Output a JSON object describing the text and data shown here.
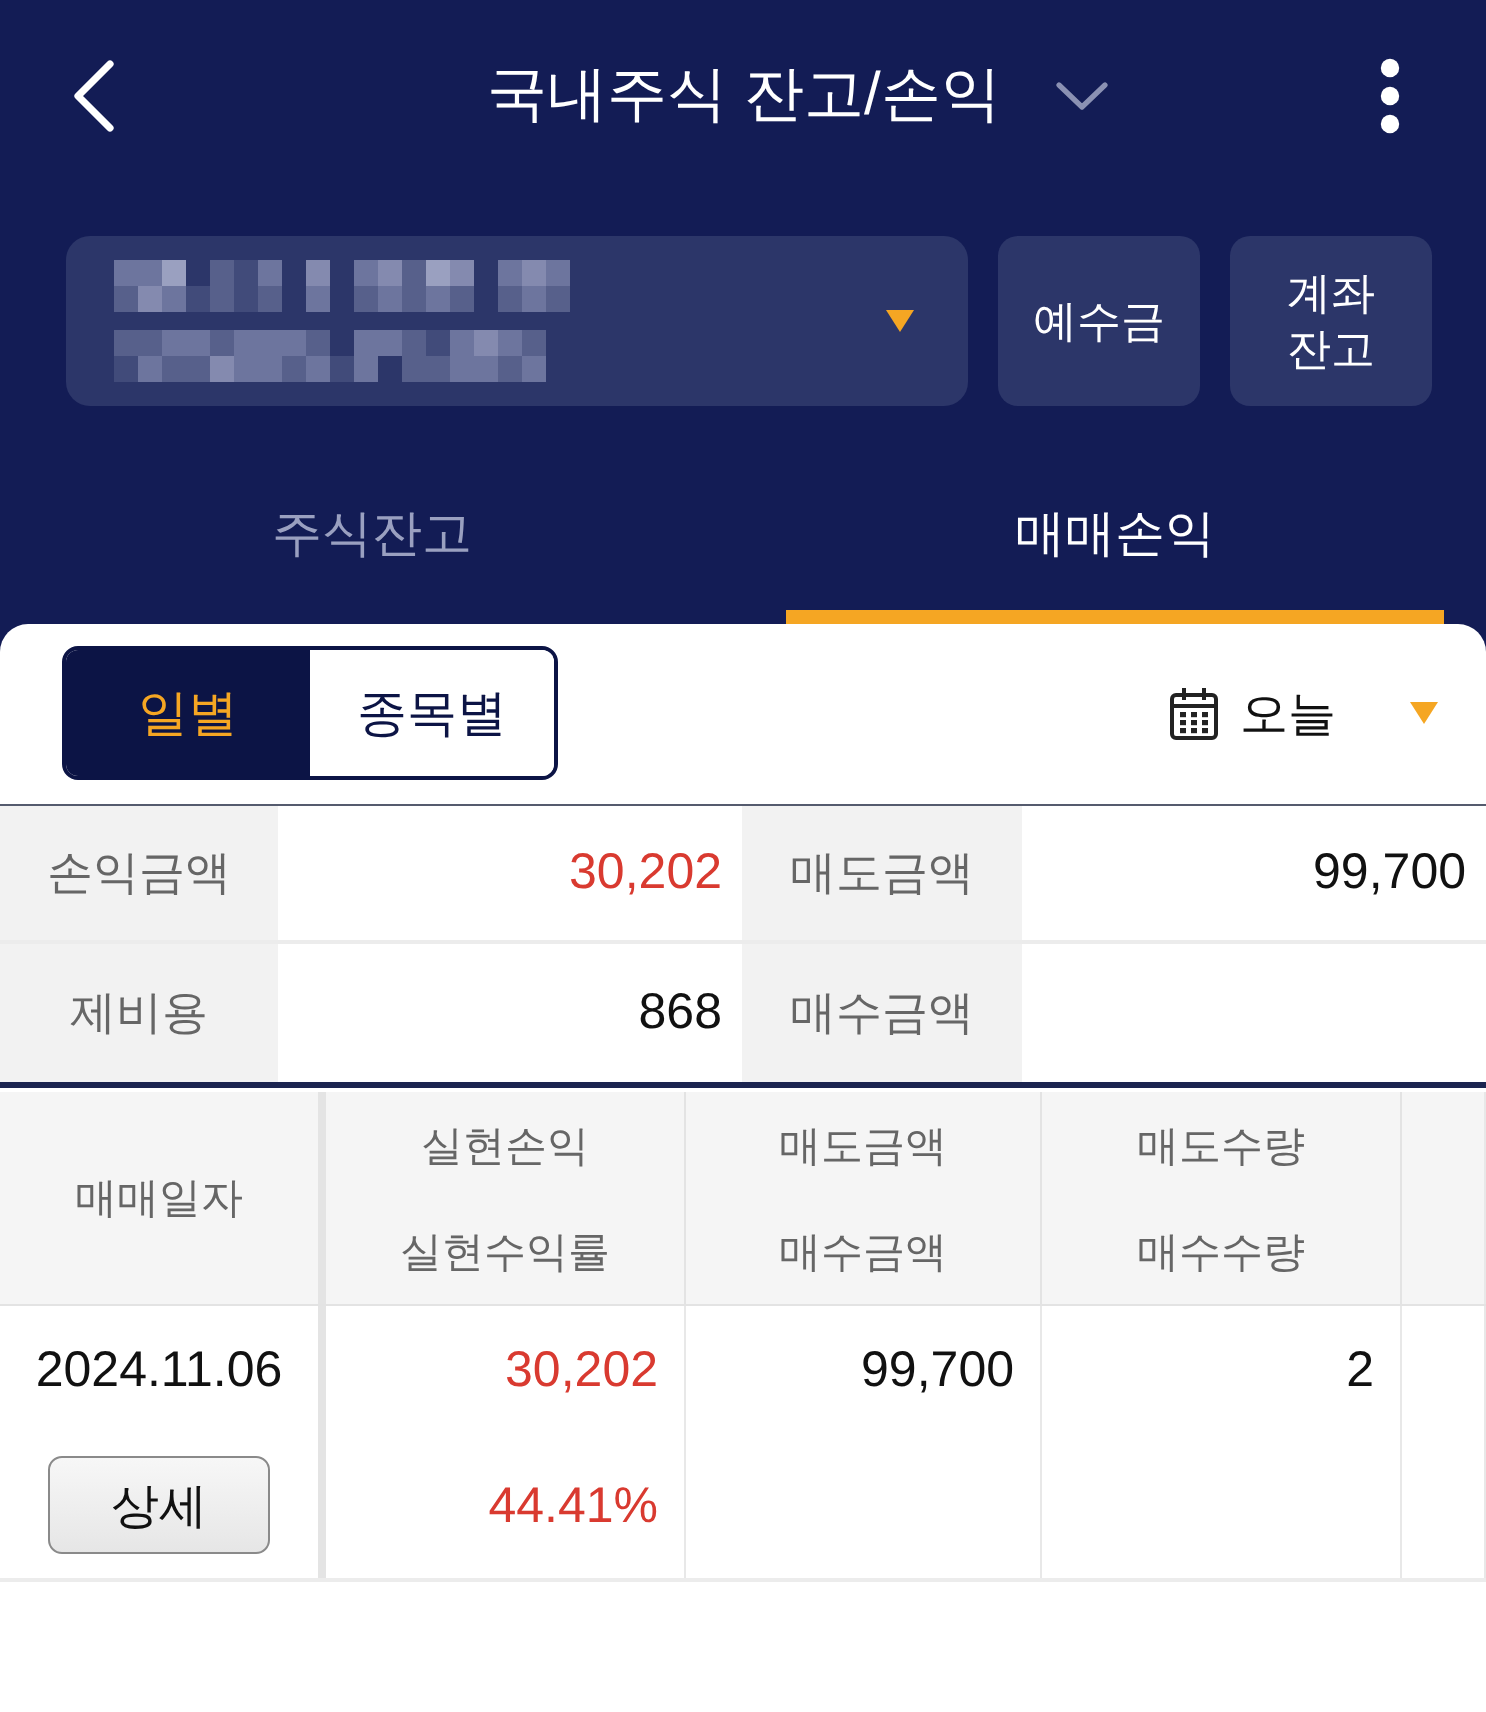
{
  "header": {
    "title": "국내주식 잔고/손익"
  },
  "account": {
    "buttons": [
      "예수금",
      "계좌 잔고"
    ]
  },
  "tabs": [
    {
      "label": "주식잔고",
      "selected": false
    },
    {
      "label": "매매손익",
      "selected": true
    }
  ],
  "view_toggle": [
    {
      "label": "일별",
      "selected": true
    },
    {
      "label": "종목별",
      "selected": false
    }
  ],
  "period": {
    "value": "오늘"
  },
  "summary": [
    {
      "label": "손익금액",
      "value": "30,202",
      "color": "#d93a30"
    },
    {
      "label": "매도금액",
      "value": "99,700",
      "color": "#111111"
    },
    {
      "label": "제비용",
      "value": "868",
      "color": "#111111"
    },
    {
      "label": "매수금액"
    }
  ],
  "table": {
    "header_rows": [
      [
        {
          "text": "매매일자",
          "rowspan": 2
        },
        {
          "text": "실현손익"
        },
        {
          "text": "매도금액"
        },
        {
          "text": "매도수량"
        }
      ],
      [
        {
          "text": "실현수익률"
        },
        {
          "text": "매수금액"
        },
        {
          "text": "매수수량"
        }
      ]
    ],
    "rows": [
      {
        "date": "2024.11.06",
        "button": "상세",
        "cells": [
          [
            {
              "text": "30,202",
              "color": "#d93a30"
            },
            {
              "text": "44.41%",
              "color": "#d93a30"
            }
          ],
          [
            {
              "text": "99,700",
              "color": "#111111"
            }
          ],
          [
            {
              "text": "2",
              "color": "#111111"
            }
          ]
        ]
      }
    ]
  }
}
